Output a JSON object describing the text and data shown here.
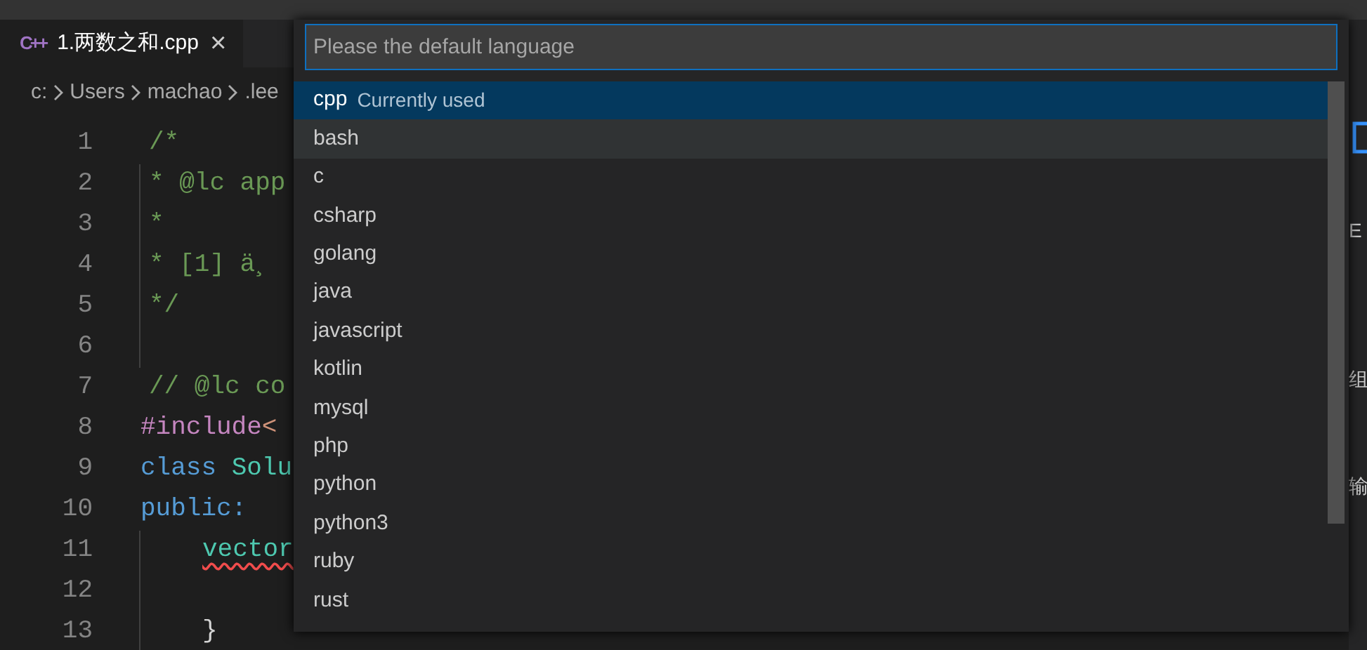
{
  "tab": {
    "icon": "C++",
    "label": "1.两数之和.cpp",
    "close": "×",
    "selected": true
  },
  "breadcrumb": [
    "c:",
    "Users",
    "machao",
    ".lee"
  ],
  "code_lines": [
    {
      "number": "1",
      "guide": false,
      "tokens": [
        {
          "text": "/*",
          "kind": "comment"
        }
      ]
    },
    {
      "number": "2",
      "guide": true,
      "tokens": [
        {
          "text": "* @lc app",
          "kind": "comment"
        }
      ]
    },
    {
      "number": "3",
      "guide": true,
      "tokens": [
        {
          "text": "*",
          "kind": "comment"
        }
      ]
    },
    {
      "number": "4",
      "guide": true,
      "tokens": [
        {
          "text": "* [1] ä¸",
          "kind": "comment"
        }
      ]
    },
    {
      "number": "5",
      "guide": true,
      "tokens": [
        {
          "text": "*/",
          "kind": "comment"
        }
      ]
    },
    {
      "number": "6",
      "guide": true
    },
    {
      "number": "7",
      "guide": false,
      "tokens": [
        {
          "text": "// @lc co",
          "kind": "comment"
        }
      ]
    },
    {
      "number": "8",
      "guide": false,
      "tokens": [
        {
          "text": "#include",
          "kind": "preproc"
        },
        {
          "text": "<",
          "kind": "string"
        }
      ]
    },
    {
      "number": "9",
      "guide": false,
      "tokens": [
        {
          "text": "class",
          "kind": "keyword"
        },
        {
          "text": "Solu",
          "kind": "type",
          "space_before": true
        }
      ]
    },
    {
      "number": "10",
      "guide": false,
      "tokens": [
        {
          "text": "public:",
          "kind": "keyword"
        }
      ]
    },
    {
      "number": "11",
      "guide": true,
      "indented": true,
      "tokens": [
        {
          "text": "vector",
          "kind": "error"
        }
      ]
    },
    {
      "number": "12",
      "guide": true
    },
    {
      "number": "13",
      "guide": true,
      "indented": true,
      "tokens": [
        {
          "text": "}",
          "kind": "plain"
        }
      ]
    }
  ],
  "quick_pick": {
    "placeholder": "Please the default language",
    "items": [
      {
        "label": "cpp",
        "description": "Currently used",
        "selected": true,
        "hovered": false
      },
      {
        "label": "bash",
        "selected": false,
        "hovered": true
      },
      {
        "label": "c",
        "selected": false,
        "hovered": false
      },
      {
        "label": "csharp",
        "selected": false,
        "hovered": false
      },
      {
        "label": "golang",
        "selected": false,
        "hovered": false
      },
      {
        "label": "java",
        "selected": false,
        "hovered": false
      },
      {
        "label": "javascript",
        "selected": false,
        "hovered": false
      },
      {
        "label": "kotlin",
        "selected": false,
        "hovered": false
      },
      {
        "label": "mysql",
        "selected": false,
        "hovered": false
      },
      {
        "label": "php",
        "selected": false,
        "hovered": false
      },
      {
        "label": "python",
        "selected": false,
        "hovered": false
      },
      {
        "label": "python3",
        "selected": false,
        "hovered": false
      },
      {
        "label": "ruby",
        "selected": false,
        "hovered": false
      },
      {
        "label": "rust",
        "selected": false,
        "hovered": false
      }
    ]
  },
  "side_panel": {
    "fragments": [
      "E",
      "组",
      "输"
    ]
  }
}
